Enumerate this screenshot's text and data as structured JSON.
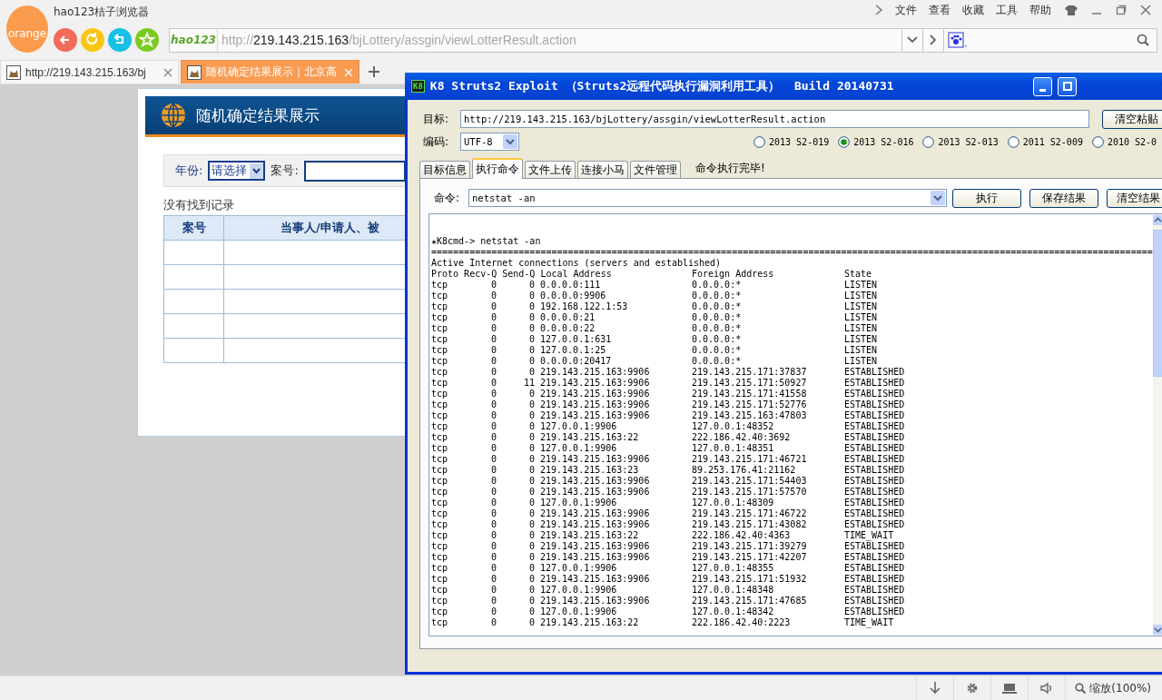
{
  "browser": {
    "app_name": "orange",
    "title": "hao123桔子浏览器",
    "menu": [
      "文件",
      "查看",
      "收藏",
      "工具",
      "帮助"
    ],
    "address": {
      "logo": "hao123",
      "scheme": "http://",
      "host": "219.143.215.163",
      "path": "/bjLottery/assgin/viewLotterResult.action"
    },
    "tabs": [
      {
        "label": "http://219.143.215.163/bj",
        "selected": false
      },
      {
        "label": "随机确定结果展示｜北京高",
        "selected": true
      }
    ],
    "zoom": "缩放(100%)"
  },
  "web_page": {
    "title": "随机确定结果展示",
    "year_label": "年份:",
    "year_value": "请选择",
    "case_label": "案号:",
    "message": "没有找到记录",
    "columns": [
      "案号",
      "当事人/申请人、被"
    ]
  },
  "exploit_window": {
    "icon_text": "K8",
    "title": "K8 Struts2 Exploit （Struts2远程代码执行漏洞利用工具）  Build 20140731",
    "target_label": "目标:",
    "target": "http://219.143.215.163/bjLottery/assgin/viewLotterResult.action",
    "clear_paste": "清空粘贴",
    "encoding_label": "编码:",
    "encoding": "UTF-8",
    "exploits": [
      {
        "label": "2013 S2-019",
        "selected": false
      },
      {
        "label": "2013 S2-016",
        "selected": true
      },
      {
        "label": "2013 S2-013",
        "selected": false
      },
      {
        "label": "2011 S2-009",
        "selected": false
      },
      {
        "label": "2010 S2-0",
        "selected": false
      }
    ],
    "tabs": [
      {
        "label": "目标信息",
        "selected": false
      },
      {
        "label": "执行命令",
        "selected": true
      },
      {
        "label": "文件上传",
        "selected": false
      },
      {
        "label": "连接小马",
        "selected": false
      },
      {
        "label": "文件管理",
        "selected": false
      }
    ],
    "status": "命令执行完毕!",
    "command_label": "命令:",
    "command": "netstat -an",
    "buttons": [
      "执行",
      "保存结果",
      "清空结果"
    ],
    "console": {
      "prompt": "★K8cmd-> netstat -an",
      "rule": "====================================================================================================================================",
      "heading": "Active Internet connections (servers and established)",
      "header": [
        "Proto Recv-Q Send-Q Local Address",
        "Foreign Address",
        "State"
      ],
      "rows": [
        [
          "tcp",
          "0",
          "0",
          "0.0.0.0:111",
          "0.0.0.0:*",
          "LISTEN"
        ],
        [
          "tcp",
          "0",
          "0",
          "0.0.0.0:9906",
          "0.0.0.0:*",
          "LISTEN"
        ],
        [
          "tcp",
          "0",
          "0",
          "192.168.122.1:53",
          "0.0.0.0:*",
          "LISTEN"
        ],
        [
          "tcp",
          "0",
          "0",
          "0.0.0.0:21",
          "0.0.0.0:*",
          "LISTEN"
        ],
        [
          "tcp",
          "0",
          "0",
          "0.0.0.0:22",
          "0.0.0.0:*",
          "LISTEN"
        ],
        [
          "tcp",
          "0",
          "0",
          "127.0.0.1:631",
          "0.0.0.0:*",
          "LISTEN"
        ],
        [
          "tcp",
          "0",
          "0",
          "127.0.0.1:25",
          "0.0.0.0:*",
          "LISTEN"
        ],
        [
          "tcp",
          "0",
          "0",
          "0.0.0.0:20417",
          "0.0.0.0:*",
          "LISTEN"
        ],
        [
          "tcp",
          "0",
          "0",
          "219.143.215.163:9906",
          "219.143.215.171:37837",
          "ESTABLISHED"
        ],
        [
          "tcp",
          "0",
          "11",
          "219.143.215.163:9906",
          "219.143.215.171:50927",
          "ESTABLISHED"
        ],
        [
          "tcp",
          "0",
          "0",
          "219.143.215.163:9906",
          "219.143.215.171:41558",
          "ESTABLISHED"
        ],
        [
          "tcp",
          "0",
          "0",
          "219.143.215.163:9906",
          "219.143.215.171:52776",
          "ESTABLISHED"
        ],
        [
          "tcp",
          "0",
          "0",
          "219.143.215.163:9906",
          "219.143.215.163:47803",
          "ESTABLISHED"
        ],
        [
          "tcp",
          "0",
          "0",
          "127.0.0.1:9906",
          "127.0.0.1:48352",
          "ESTABLISHED"
        ],
        [
          "tcp",
          "0",
          "0",
          "219.143.215.163:22",
          "222.186.42.40:3692",
          "ESTABLISHED"
        ],
        [
          "tcp",
          "0",
          "0",
          "127.0.0.1:9906",
          "127.0.0.1:48351",
          "ESTABLISHED"
        ],
        [
          "tcp",
          "0",
          "0",
          "219.143.215.163:9906",
          "219.143.215.171:46721",
          "ESTABLISHED"
        ],
        [
          "tcp",
          "0",
          "0",
          "219.143.215.163:23",
          "89.253.176.41:21162",
          "ESTABLISHED"
        ],
        [
          "tcp",
          "0",
          "0",
          "219.143.215.163:9906",
          "219.143.215.171:54403",
          "ESTABLISHED"
        ],
        [
          "tcp",
          "0",
          "0",
          "219.143.215.163:9906",
          "219.143.215.171:57570",
          "ESTABLISHED"
        ],
        [
          "tcp",
          "0",
          "0",
          "127.0.0.1:9906",
          "127.0.0.1:48309",
          "ESTABLISHED"
        ],
        [
          "tcp",
          "0",
          "0",
          "219.143.215.163:9906",
          "219.143.215.171:46722",
          "ESTABLISHED"
        ],
        [
          "tcp",
          "0",
          "0",
          "219.143.215.163:9906",
          "219.143.215.171:43082",
          "ESTABLISHED"
        ],
        [
          "tcp",
          "0",
          "0",
          "219.143.215.163:22",
          "222.186.42.40:4363",
          "TIME_WAIT"
        ],
        [
          "tcp",
          "0",
          "0",
          "219.143.215.163:9906",
          "219.143.215.171:39279",
          "ESTABLISHED"
        ],
        [
          "tcp",
          "0",
          "0",
          "219.143.215.163:9906",
          "219.143.215.171:42207",
          "ESTABLISHED"
        ],
        [
          "tcp",
          "0",
          "0",
          "127.0.0.1:9906",
          "127.0.0.1:48355",
          "ESTABLISHED"
        ],
        [
          "tcp",
          "0",
          "0",
          "219.143.215.163:9906",
          "219.143.215.171:51932",
          "ESTABLISHED"
        ],
        [
          "tcp",
          "0",
          "0",
          "127.0.0.1:9906",
          "127.0.0.1:48348",
          "ESTABLISHED"
        ],
        [
          "tcp",
          "0",
          "0",
          "219.143.215.163:9906",
          "219.143.215.171:47685",
          "ESTABLISHED"
        ],
        [
          "tcp",
          "0",
          "0",
          "127.0.0.1:9906",
          "127.0.0.1:48342",
          "ESTABLISHED"
        ],
        [
          "tcp",
          "0",
          "0",
          "219.143.215.163:22",
          "222.186.42.40:2223",
          "TIME_WAIT"
        ]
      ]
    }
  }
}
